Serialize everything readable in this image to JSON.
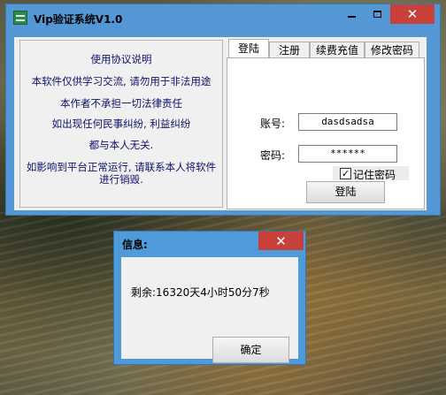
{
  "main_window": {
    "title": "Vip验证系统V1.0",
    "controls": {
      "minimize_icon": "minimize-icon",
      "maximize_icon": "maximize-icon",
      "close_glyph": "✕"
    },
    "agreement": {
      "lines": [
        "使用协议说明",
        "本软件仅供学习交流, 请勿用于非法用途",
        "本作者不承担一切法律责任",
        "如出现任何民事纠纷, 利益纠纷",
        "都与本人无关.",
        "如影响到平台正常运行, 请联系本人将软件",
        "进行销毁."
      ]
    },
    "tabs": [
      {
        "label": "登陆",
        "active": true
      },
      {
        "label": "注册",
        "active": false
      },
      {
        "label": "续费充值",
        "active": false
      },
      {
        "label": "修改密码",
        "active": false
      }
    ],
    "login": {
      "account_label": "账号:",
      "account_value": "dasdsadsa",
      "password_label": "密码:",
      "password_value": "******",
      "remember_label": "记住密码",
      "remember_checked": true,
      "remember_check_glyph": "✓",
      "login_button": "登陆"
    }
  },
  "dialog": {
    "title": "信息:",
    "close_glyph": "✕",
    "message": "剩余:16320天4小时50分7秒",
    "ok_button": "确定"
  },
  "colors": {
    "title_bar": "#5398d4",
    "close_button": "#c8403a",
    "agreement_text": "#101070"
  }
}
